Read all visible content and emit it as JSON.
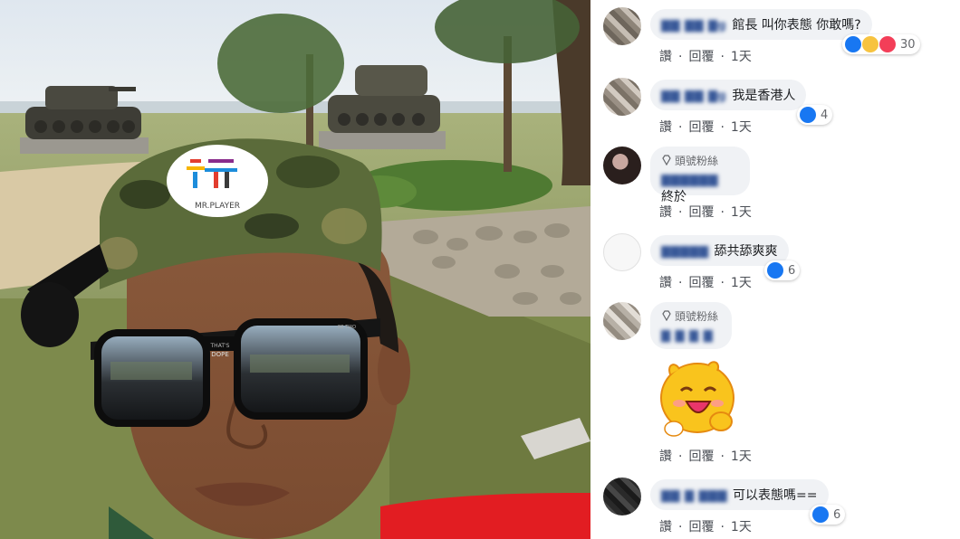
{
  "photo": {
    "cap_logo_text": "MR.PLAYER",
    "glasses_text_1": "THAT'S",
    "glasses_text_2": "DOPE",
    "glasses_text_3": "BE TWO"
  },
  "actions": {
    "like": "讚",
    "reply": "回覆",
    "time": "1天",
    "dot": "·"
  },
  "comments": [
    {
      "name": "▇▇ ▇▇ ▇g",
      "text": "館長 叫你表態 你敢嗎?",
      "reactions": [
        "like",
        "haha",
        "love"
      ],
      "count": "30"
    },
    {
      "name": "▇▇ ▇▇ ▇g",
      "text": "我是香港人",
      "reactions": [
        "like"
      ],
      "count": "4"
    },
    {
      "badge": "頭號粉絲",
      "name": "▇▇▇▇▇▇",
      "text": "終於"
    },
    {
      "name": "▇▇▇▇▇",
      "text": "舔共舔爽爽",
      "reactions": [
        "like"
      ],
      "count": "6"
    },
    {
      "badge": "頭號粉絲",
      "name": "▇ ▇ ▇ ▇",
      "text": "",
      "sticker": "smiling-blob-sticker"
    },
    {
      "name": "▇▇ ▇ ▇▇▇",
      "text": "可以表態嗎==",
      "reactions": [
        "like"
      ],
      "count": "6"
    }
  ]
}
